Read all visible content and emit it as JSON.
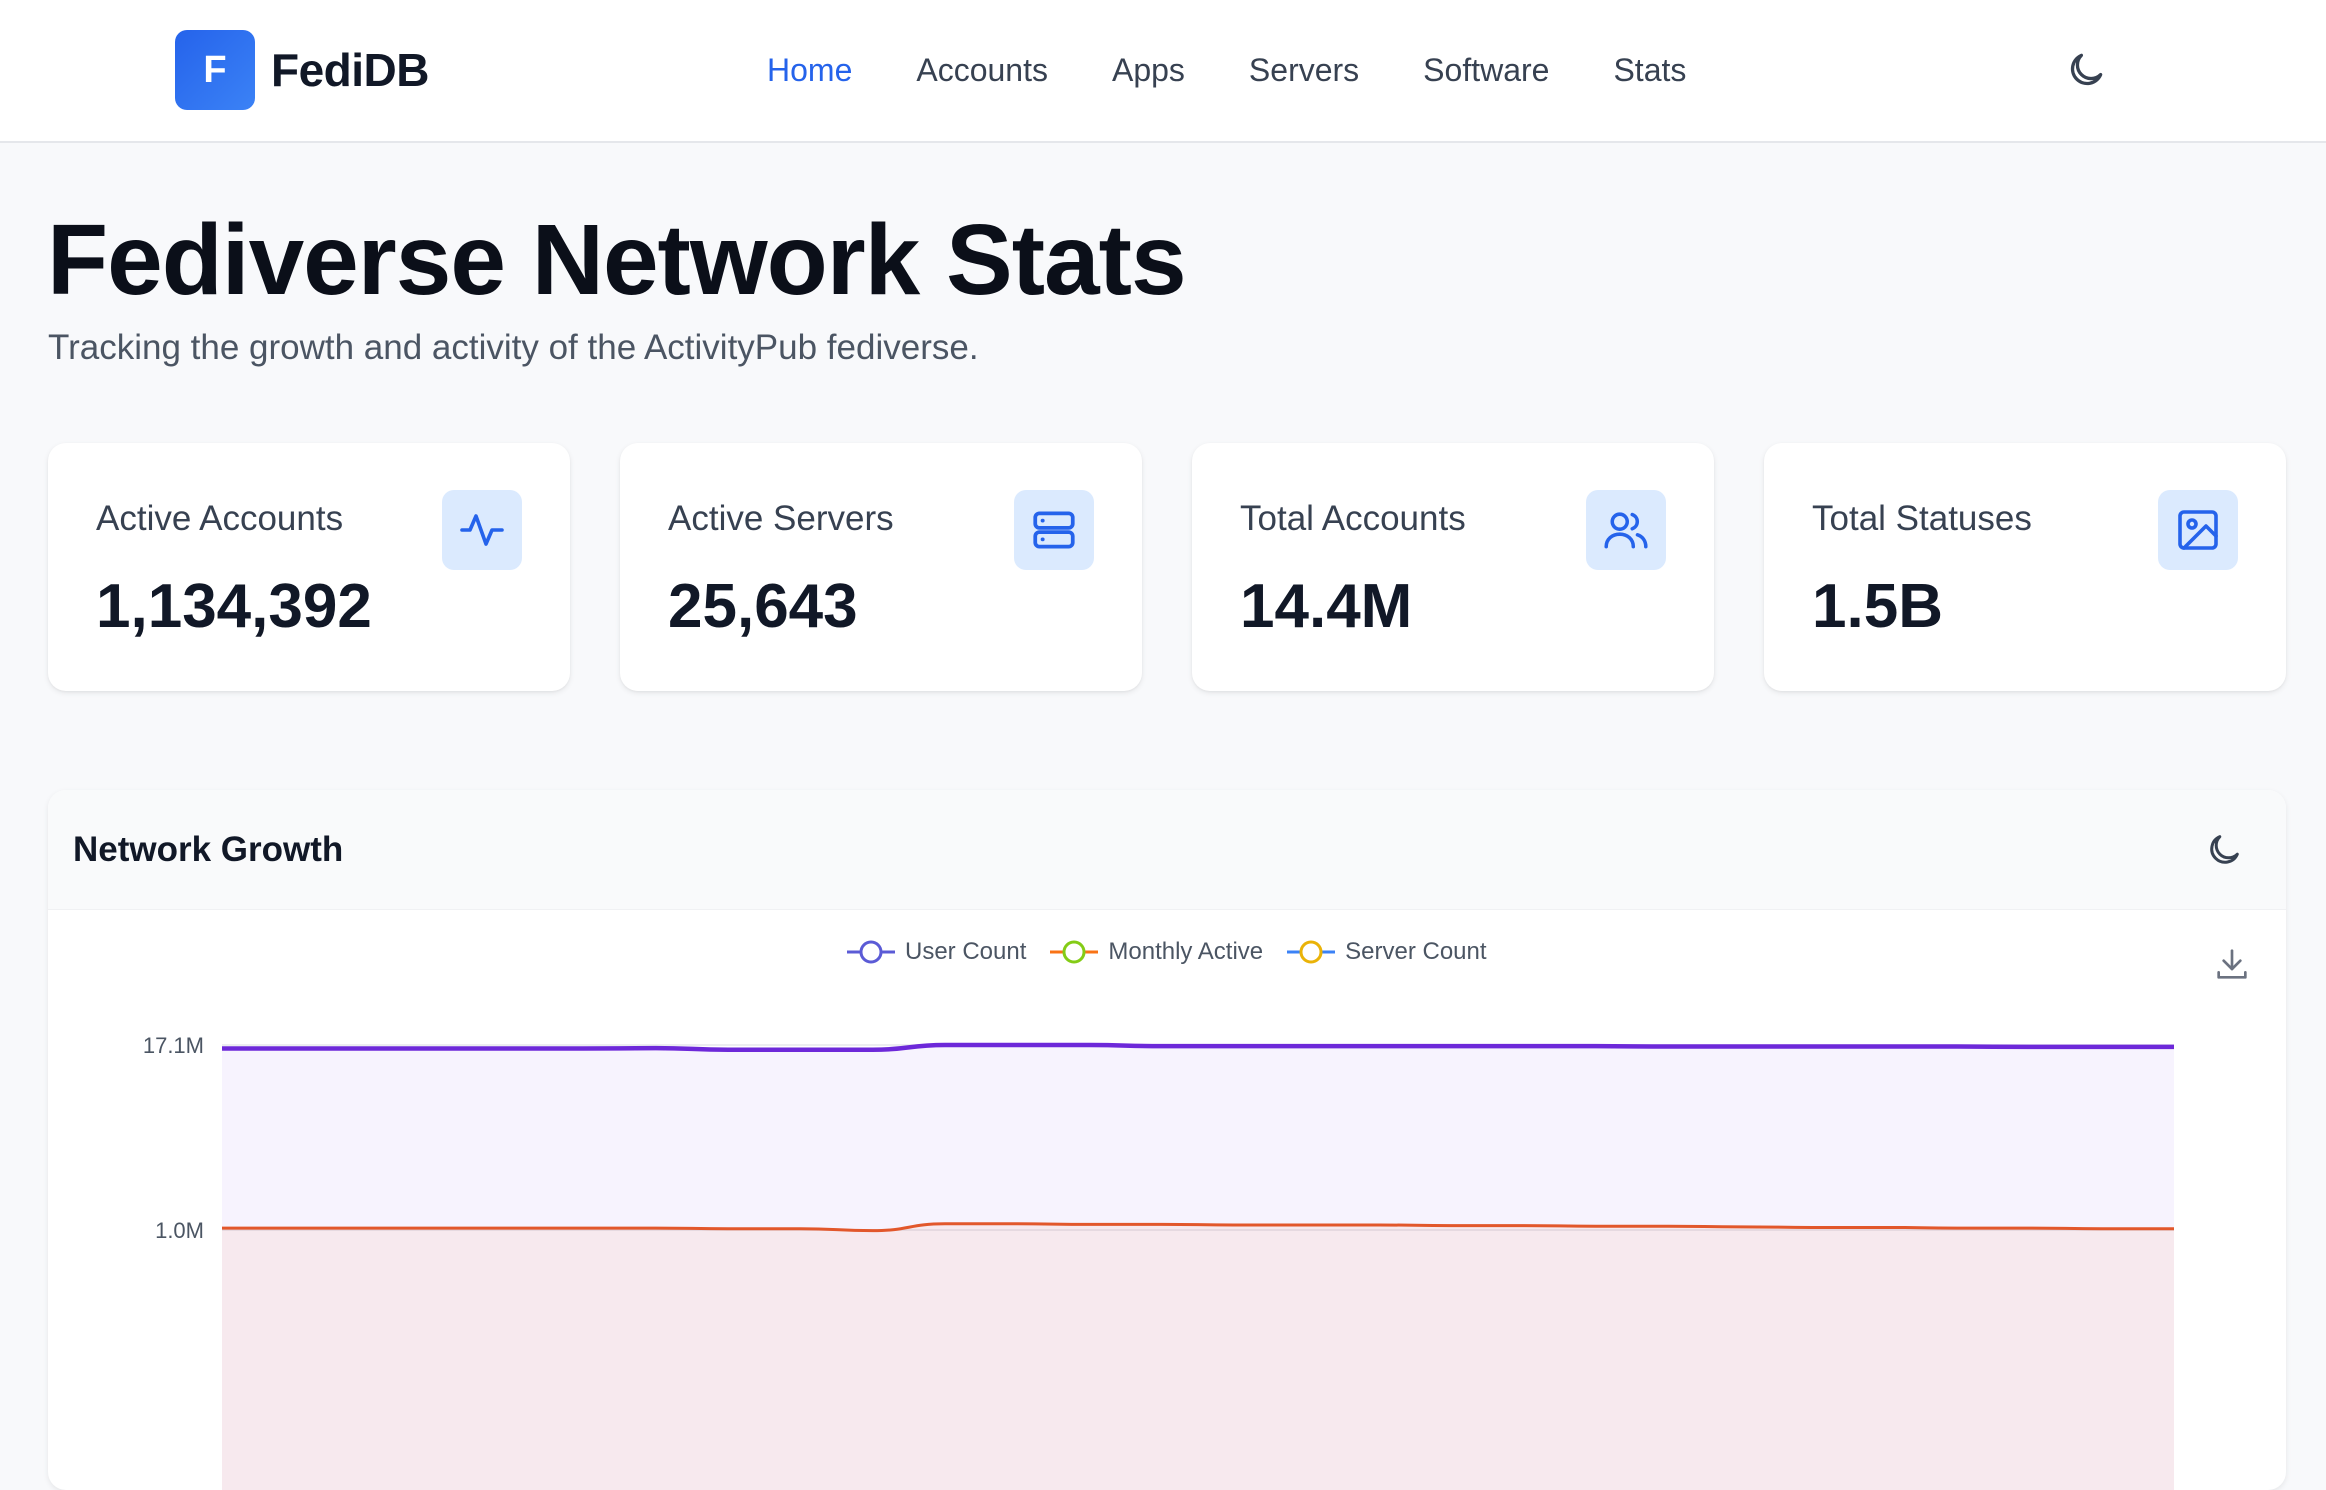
{
  "app": {
    "logo_letter": "F",
    "name": "FediDB"
  },
  "nav": {
    "items": [
      {
        "label": "Home",
        "active": true
      },
      {
        "label": "Accounts"
      },
      {
        "label": "Apps"
      },
      {
        "label": "Servers"
      },
      {
        "label": "Software"
      },
      {
        "label": "Stats"
      }
    ],
    "theme_icon": "moon-icon"
  },
  "page": {
    "title": "Fediverse Network Stats",
    "subtitle": "Tracking the growth and activity of the ActivityPub fediverse."
  },
  "cards": [
    {
      "label": "Active Accounts",
      "value": "1,134,392",
      "icon": "activity-icon"
    },
    {
      "label": "Active Servers",
      "value": "25,643",
      "icon": "server-icon"
    },
    {
      "label": "Total Accounts",
      "value": "14.4M",
      "icon": "users-icon"
    },
    {
      "label": "Total Statuses",
      "value": "1.5B",
      "icon": "image-icon"
    }
  ],
  "panel": {
    "title": "Network Growth",
    "theme_icon": "moon-icon",
    "download_icon": "download-icon"
  },
  "colors": {
    "accent": "#2563eb",
    "card_icon_bg": "#dbeafe"
  },
  "chart_data": {
    "type": "area",
    "legend_position": "top-center",
    "series": [
      {
        "name": "User Count",
        "color": "#6d28d9",
        "values": [
          16.2,
          16.2,
          16.2,
          16.2,
          16.2,
          16.2,
          16.3,
          15.9,
          15.9,
          15.9,
          17.1,
          17.1,
          17.1,
          16.8,
          16.8,
          16.8,
          16.8,
          16.8,
          16.8,
          16.8,
          16.7,
          16.7,
          16.7,
          16.7,
          16.7,
          16.6,
          16.6,
          16.6
        ]
      },
      {
        "name": "Monthly Active",
        "color": "#f97316",
        "values": [
          1.03,
          1.03,
          1.03,
          1.03,
          1.03,
          1.03,
          1.03,
          1.02,
          1.02,
          0.99,
          1.1,
          1.1,
          1.09,
          1.09,
          1.08,
          1.08,
          1.08,
          1.07,
          1.07,
          1.06,
          1.06,
          1.05,
          1.04,
          1.04,
          1.03,
          1.03,
          1.02,
          1.02
        ]
      },
      {
        "name": "Server Count",
        "color": "#eab308",
        "values": []
      }
    ],
    "y_ticks": [
      "17.1M",
      "1.0M"
    ],
    "ylim": [
      0,
      17.1
    ],
    "scale": "log"
  }
}
